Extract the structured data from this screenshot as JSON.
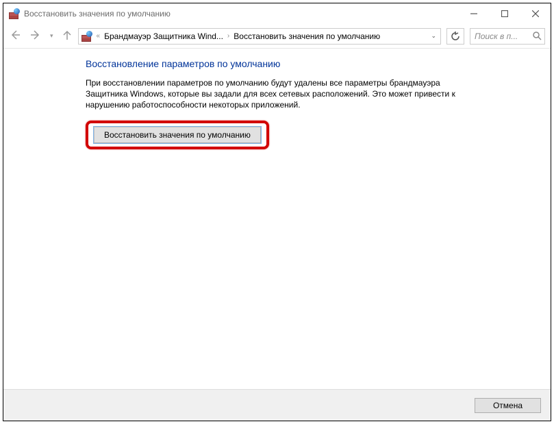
{
  "window": {
    "title": "Восстановить значения по умолчанию"
  },
  "breadcrumb": {
    "item1": "Брандмауэр Защитника Wind...",
    "item2": "Восстановить значения по умолчанию"
  },
  "search": {
    "placeholder": "Поиск в п..."
  },
  "content": {
    "heading": "Восстановление параметров по умолчанию",
    "body": "При восстановлении параметров по умолчанию будут удалены все параметры брандмауэра Защитника Windows, которые вы задали для всех сетевых расположений. Это может привести к нарушению работоспособности некоторых приложений.",
    "restore_button": "Восстановить значения по умолчанию"
  },
  "footer": {
    "cancel": "Отмена"
  }
}
